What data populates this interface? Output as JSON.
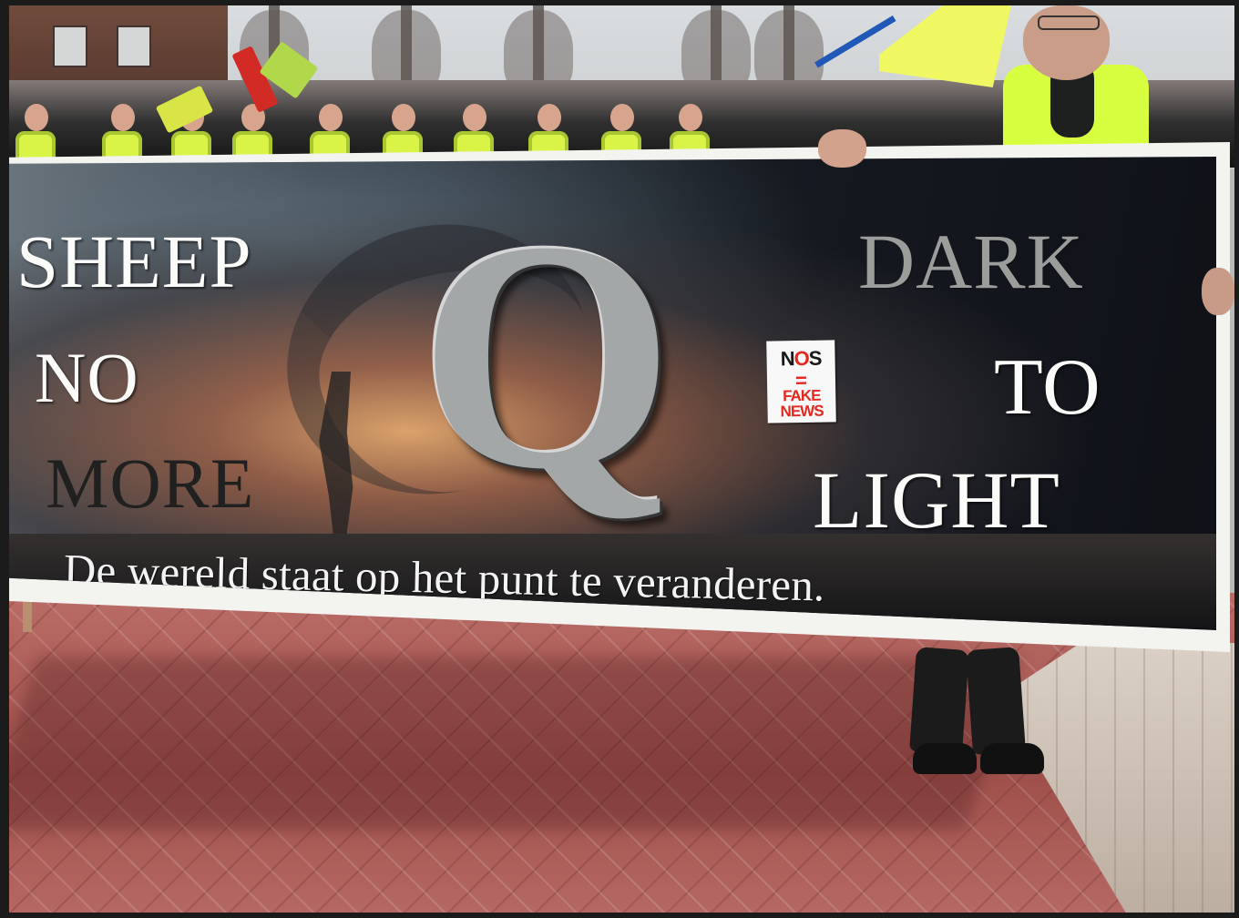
{
  "banner": {
    "left_words": [
      "SHEEP",
      "NO",
      "MORE"
    ],
    "center_letter": "Q",
    "right_words": [
      "DARK",
      "TO",
      "LIGHT"
    ],
    "tagline": "De wereld staat op het punt te veranderen."
  },
  "sticker": {
    "title_prefix": "N",
    "title_o": "O",
    "title_suffix": "S",
    "equals": "=",
    "line1": "FAKE",
    "line2": "NEWS"
  },
  "colors": {
    "banner_text": "#fbfbf9",
    "dark_text": "#9b9d9b",
    "vest": "#d9f346",
    "pavement": "#ba6c66",
    "sticker_red": "#e4271f"
  }
}
